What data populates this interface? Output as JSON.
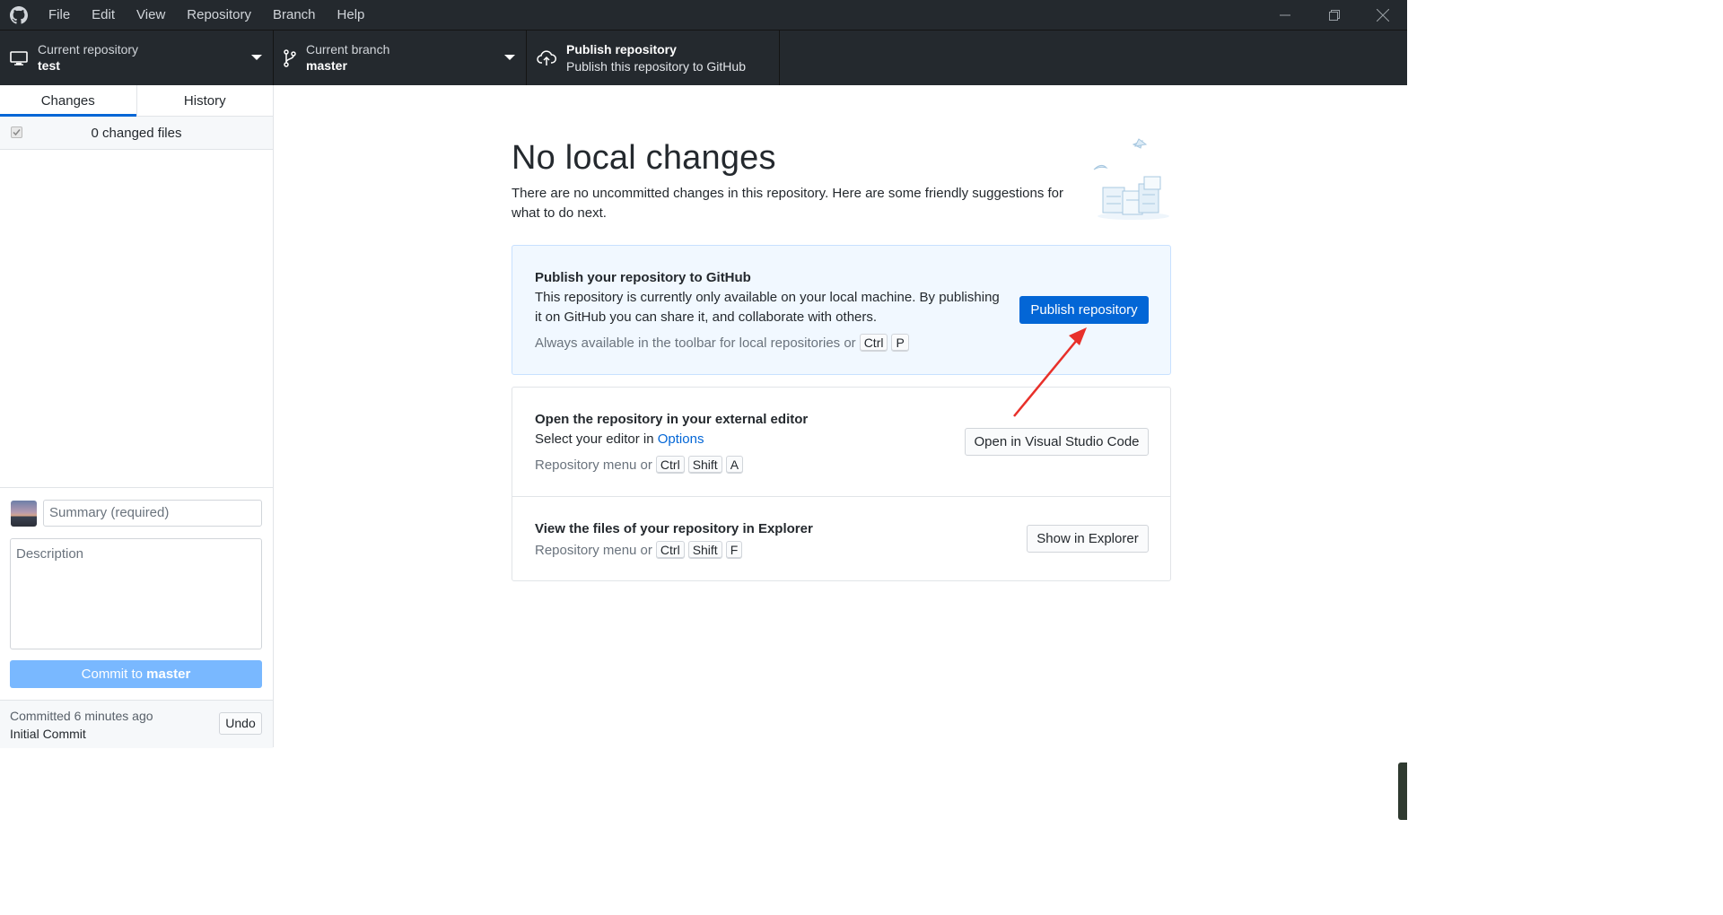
{
  "menu": [
    "File",
    "Edit",
    "View",
    "Repository",
    "Branch",
    "Help"
  ],
  "toolbar": {
    "repo_label": "Current repository",
    "repo_value": "test",
    "branch_label": "Current branch",
    "branch_value": "master",
    "publish_label": "Publish repository",
    "publish_sub": "Publish this repository to GitHub"
  },
  "sidebar": {
    "tab_changes": "Changes",
    "tab_history": "History",
    "changed_files": "0 changed files",
    "summary_placeholder": "Summary (required)",
    "description_placeholder": "Description",
    "commit_prefix": "Commit to ",
    "commit_branch": "master",
    "last_commit_time": "Committed 6 minutes ago",
    "last_commit_msg": "Initial Commit",
    "undo": "Undo"
  },
  "main": {
    "heading": "No local changes",
    "subtext": "There are no uncommitted changes in this repository. Here are some friendly suggestions for what to do next.",
    "publish": {
      "title": "Publish your repository to GitHub",
      "text": "This repository is currently only available on your local machine. By publishing it on GitHub you can share it, and collaborate with others.",
      "hint": "Always available in the toolbar for local repositories or",
      "keys": [
        "Ctrl",
        "P"
      ],
      "button": "Publish repository"
    },
    "editor": {
      "title": "Open the repository in your external editor",
      "text_prefix": "Select your editor in",
      "link": "Options",
      "hint": "Repository menu or",
      "keys": [
        "Ctrl",
        "Shift",
        "A"
      ],
      "button": "Open in Visual Studio Code"
    },
    "explorer": {
      "title": "View the files of your repository in Explorer",
      "hint": "Repository menu or",
      "keys": [
        "Ctrl",
        "Shift",
        "F"
      ],
      "button": "Show in Explorer"
    }
  },
  "colors": {
    "titlebar": "#24292e",
    "accent": "#0366d6",
    "commit_button": "#79b8ff",
    "annotation_arrow": "#e8302a"
  }
}
